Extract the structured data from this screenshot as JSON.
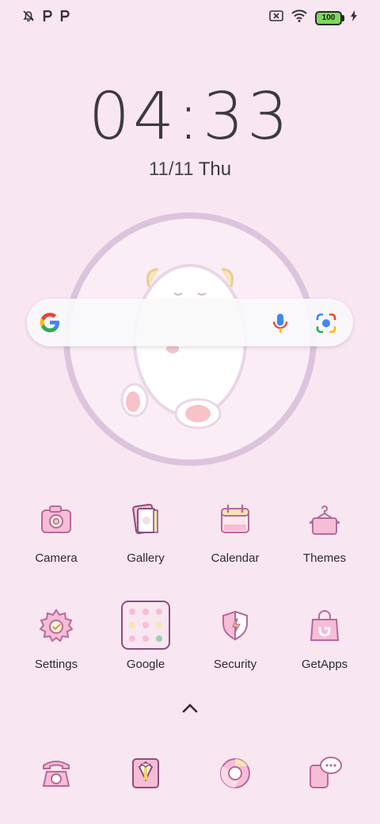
{
  "status_bar": {
    "left_icons": [
      "notifications-off-icon",
      "p-icon",
      "p-icon"
    ],
    "right_icons": [
      "sim-x-icon",
      "wifi-icon",
      "battery-icon",
      "charging-icon"
    ],
    "battery_level": "100"
  },
  "lockscreen": {
    "time": "04:33",
    "date": "11/11",
    "day": "Thu"
  },
  "search_bar": {
    "icons": [
      "google-g-icon",
      "mic-icon",
      "lens-icon"
    ]
  },
  "apps": [
    {
      "label": "Camera",
      "icon": "camera-icon"
    },
    {
      "label": "Gallery",
      "icon": "gallery-icon"
    },
    {
      "label": "Calendar",
      "icon": "calendar-icon"
    },
    {
      "label": "Themes",
      "icon": "themes-icon"
    },
    {
      "label": "Settings",
      "icon": "settings-icon"
    },
    {
      "label": "Google",
      "icon": "google-folder-icon"
    },
    {
      "label": "Security",
      "icon": "security-icon"
    },
    {
      "label": "GetApps",
      "icon": "getapps-icon"
    }
  ],
  "dock": [
    {
      "icon": "phone-icon"
    },
    {
      "icon": "contacts-icon"
    },
    {
      "icon": "chrome-icon"
    },
    {
      "icon": "messages-icon"
    }
  ],
  "colors": {
    "background": "#f8e6f1",
    "icon_pink": "#f7b8d4",
    "icon_stroke": "#b66a9c"
  }
}
